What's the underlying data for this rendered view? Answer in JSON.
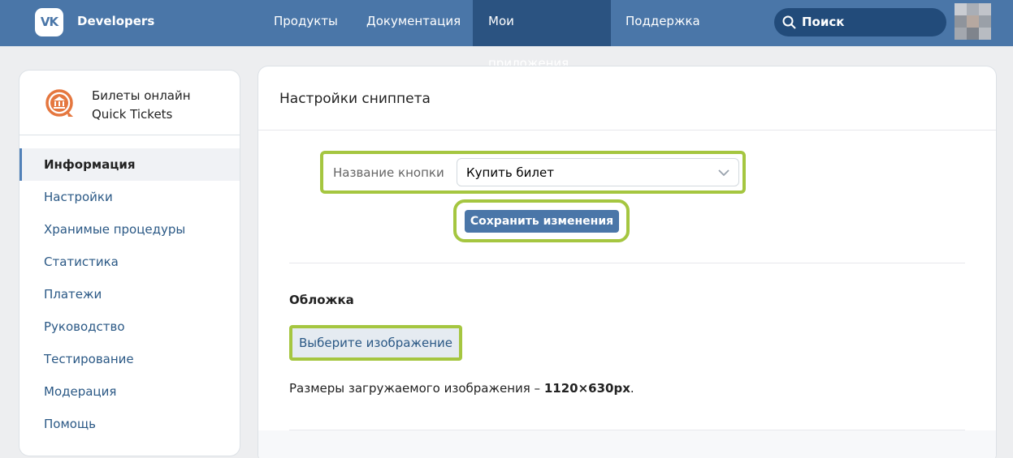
{
  "header": {
    "logo": "VK",
    "brand": "Developers",
    "nav": [
      {
        "label": "Продукты"
      },
      {
        "label": "Документация"
      },
      {
        "label": "Мои приложения"
      },
      {
        "label": "Поддержка"
      }
    ],
    "active_nav": "Мои приложения",
    "search_placeholder": "Поиск"
  },
  "sidebar": {
    "app_title": "Билеты онлайн",
    "app_subtitle": "Quick Tickets",
    "items": [
      {
        "label": "Информация"
      },
      {
        "label": "Настройки"
      },
      {
        "label": "Хранимые процедуры"
      },
      {
        "label": "Статистика"
      },
      {
        "label": "Платежи"
      },
      {
        "label": "Руководство"
      },
      {
        "label": "Тестирование"
      },
      {
        "label": "Модерация"
      },
      {
        "label": "Помощь"
      }
    ],
    "active_item": "Информация"
  },
  "main": {
    "title": "Настройки сниппета",
    "button_name_label": "Название кнопки",
    "button_name_value": "Купить билет",
    "save_label": "Сохранить изменения",
    "cover_title": "Обложка",
    "choose_image_label": "Выберите изображение",
    "size_note_prefix": "Размеры загружаемого изображения –",
    "size_note_value": "1120×630px",
    "size_note_suffix": "."
  },
  "colors": {
    "header_bg": "#4a76a8",
    "active_nav_bg": "#2b5381",
    "highlight": "#a5c640",
    "link": "#2a5885",
    "app_icon": "#e5773f"
  }
}
